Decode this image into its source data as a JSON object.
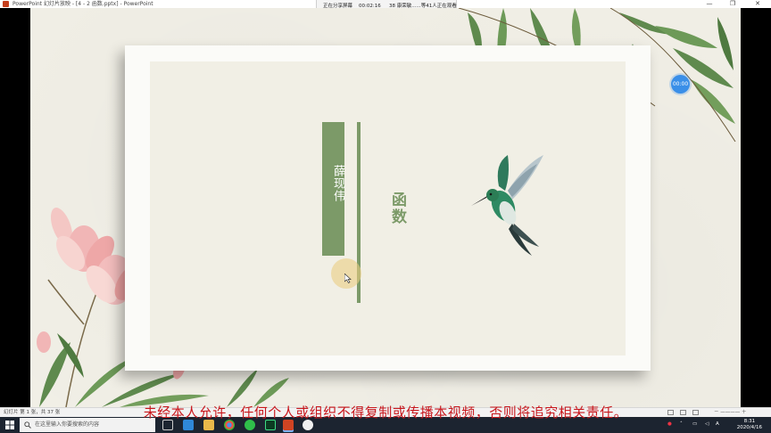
{
  "window": {
    "title": "PowerPoint 幻灯片放映 - [4 - 2 函数.pptx] - PowerPoint",
    "min_glyph": "—",
    "max_glyph": "❐",
    "close_glyph": "✕"
  },
  "share_banner": {
    "label": "正在分享屏幕",
    "elapsed": "00:02:16",
    "viewers": "38 康荣敏......等41人正在观看"
  },
  "slide": {
    "author": "薛现伟",
    "title": "函数",
    "timer": "00:00"
  },
  "watermark": {
    "text": "未经本人允许，任何个人或组织不得复制或传播本视频，否则将追究相关责任。"
  },
  "statusbar": {
    "slide_info": "幻灯片 第 1 张，共 37 张",
    "zoom_glyphs": "－ ———— ＋"
  },
  "taskbar": {
    "search_placeholder": "在这里输入你要搜索的内容",
    "apps": [
      "task-view-icon",
      "edge-icon",
      "explorer-icon",
      "chrome-icon",
      "wechat-icon",
      "dreamweaver-icon",
      "powerpoint-icon",
      "meeting-icon"
    ],
    "ime": "A",
    "time": "8:31",
    "date": "2020/4/16"
  },
  "colors": {
    "accent_green": "#7c9a68",
    "watermark_red": "#c8171c",
    "timer_blue": "#3a8fe8",
    "taskbar_bg": "#1c2430"
  }
}
